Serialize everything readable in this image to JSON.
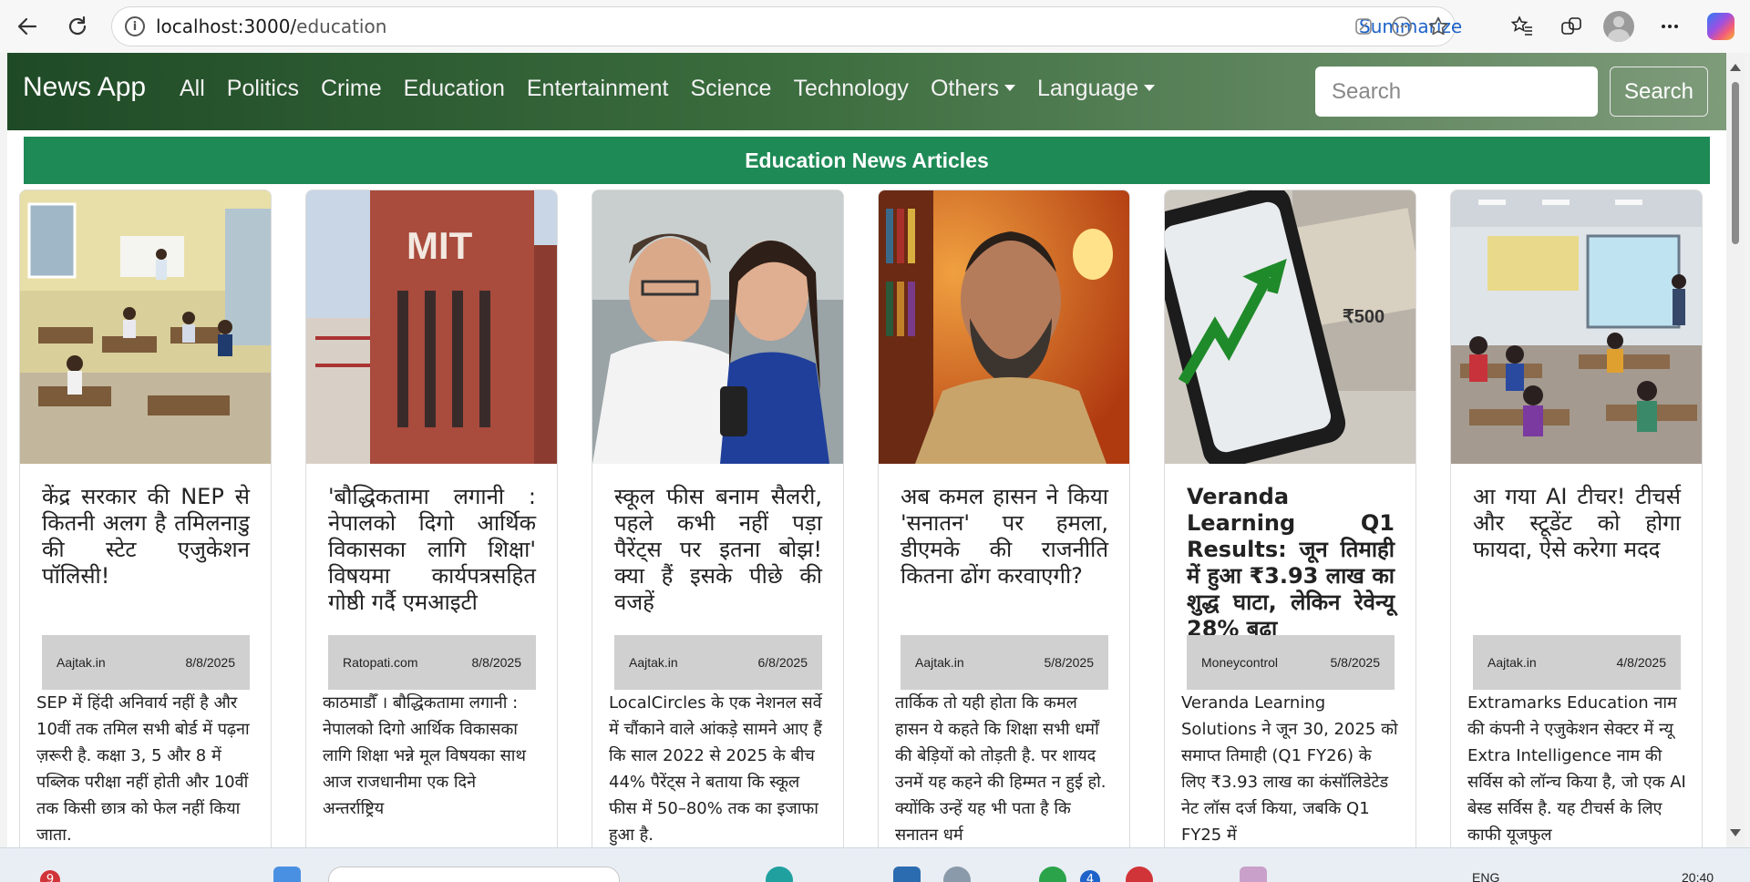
{
  "browser": {
    "url_host": "localhost:3000/",
    "url_path": "education",
    "summarize_label": "Summarize",
    "nav_back_icon": "arrow-left-icon",
    "reload_icon": "reload-icon"
  },
  "navbar": {
    "brand": "News App",
    "links": [
      "All",
      "Politics",
      "Crime",
      "Education",
      "Entertainment",
      "Science",
      "Technology"
    ],
    "dropdowns": [
      "Others",
      "Language"
    ],
    "search_placeholder": "Search",
    "search_button": "Search",
    "gradient_start": "#1f4a26",
    "gradient_end": "#7e9b7a"
  },
  "section": {
    "title": "Education News Articles",
    "color": "#1e8a56"
  },
  "articles": [
    {
      "title": "केंद्र सरकार की NEP से कितनी अलग है तमिलनाडु की स्टेट एजुकेशन पॉलिसी!",
      "source": "Aajtak.in",
      "date": "8/8/2025",
      "description": "SEP में हिंदी अनिवार्य नहीं है और 10वीं तक तमिल सभी बोर्ड में पढ़ना ज़रूरी है. कक्षा 3, 5 और 8 में पब्लिक परीक्षा नहीं होती और 10वीं तक किसी छात्र को फेल नहीं किया जाता.",
      "image": "classroom-exam-image"
    },
    {
      "title": "'बौद्धिकतामा लगानी : नेपालको दिगो आर्थिक विकासका लागि शिक्षा' विषयमा कार्यपत्रसहित गोष्ठी गर्दै एमआइटी",
      "source": "Ratopati.com",
      "date": "8/8/2025",
      "description": "काठमाडौँ । बौद्धिकतामा लगानी : नेपालको दिगो आर्थिक विकासका लागि शिक्षा भन्ने मूल विषयका साथ आज राजधानीमा एक दिने अन्तर्राष्ट्रिय",
      "image": "mit-building-image"
    },
    {
      "title": "स्कूल फीस बनाम सैलरी, पहले कभी नहीं पड़ा पैरेंट्स पर इतना बोझ! क्या हैं इसके पीछे की वजहें",
      "source": "Aajtak.in",
      "date": "6/8/2025",
      "description": "LocalCircles के एक नेशनल सर्वे में चौंकाने वाले आंकड़े सामने आए हैं कि साल 2022 से 2025 के बीच 44% पैरेंट्स ने बताया कि स्कूल फीस में 50–80% तक का इजाफा हुआ है.",
      "image": "worried-parents-image"
    },
    {
      "title": "अब कमल हासन ने किया 'सनातन' पर हमला, डीएमके की राजनीति कितना ढोंग करवाएगी?",
      "source": "Aajtak.in",
      "date": "5/8/2025",
      "description": "तार्किक तो यही होता कि कमल हासन ये कहते कि शिक्षा सभी धर्मों की बेड़ियों को तोड़ती है. पर शायद उनमें यह कहने की हिम्मत न हुई हो. क्योंकि उन्हें यह भी पता है कि सनातन धर्म",
      "image": "kamal-haasan-portrait-image"
    },
    {
      "title": "Veranda Learning Q1 Results: जून तिमाही में हुआ ₹3.93 लाख का शुद्ध घाटा, लेकिन रेवेन्यू 28% बढ़ा",
      "source": "Moneycontrol",
      "date": "5/8/2025",
      "description": "Veranda Learning Solutions ने जून 30, 2025 को समाप्त तिमाही (Q1 FY26) के लिए ₹3.93 लाख का कंसॉलिडेटेड नेट लॉस दर्ज किया, जबकि Q1 FY25 में",
      "image": "phone-chart-currency-image"
    },
    {
      "title": "आ गया AI टीचर! टीचर्स और स्टूडेंट को होगा फायदा, ऐसे करेगा मदद",
      "source": "Aajtak.in",
      "date": "4/8/2025",
      "description": "Extramarks Education नाम की कंपनी ने एजुकेशन सेक्टर में न्यू Extra Intelligence नाम की सर्विस को लॉन्च किया है, जो एक AI बेस्ड सर्विस है. यह टीचर्स के लिए काफी यूजफुल",
      "image": "smart-classroom-image"
    }
  ],
  "taskbar": {
    "notification_count": "9",
    "app_badge": "4",
    "lang": "ENG",
    "time": "20:40"
  }
}
